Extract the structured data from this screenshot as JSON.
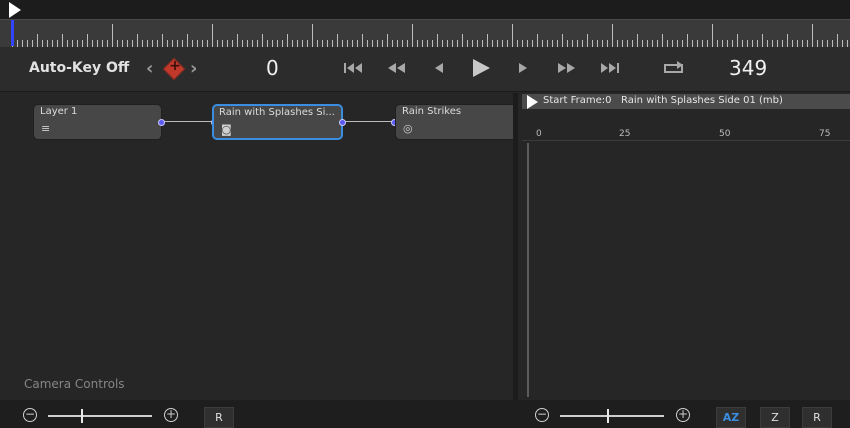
{
  "timeline": {
    "start_marker": "play-marker"
  },
  "transport": {
    "autokey_label": "Auto-Key Off",
    "key_prev": "‹",
    "key_next": "›",
    "key_add": "+",
    "current_frame": "0",
    "end_frame": "349",
    "buttons": [
      "go-to-start",
      "step-back-many",
      "step-back",
      "play",
      "step-forward",
      "step-forward-many",
      "go-to-end",
      "loop"
    ]
  },
  "graph": {
    "nodes": [
      {
        "title": "Layer 1",
        "icon": "layers-icon",
        "selected": false
      },
      {
        "title": "Rain with Splashes Si...",
        "icon": "emitter-icon",
        "selected": true
      },
      {
        "title": "Rain Strikes",
        "icon": "target-icon",
        "selected": false
      }
    ],
    "camera_label": "Camera Controls"
  },
  "timeline_panel": {
    "start_label": "Start Frame:0",
    "track_name": "Rain with Splashes Side 01 (mb)",
    "ticks": [
      "0",
      "25",
      "50",
      "75"
    ]
  },
  "bottom": {
    "left_reset": "R",
    "right_az": "AZ",
    "right_z": "Z",
    "right_reset": "R",
    "zoom_out": "−",
    "zoom_in": "+"
  },
  "colors": {
    "accent": "#3b8de0",
    "key": "#c0392b",
    "playhead": "#3344ff"
  }
}
